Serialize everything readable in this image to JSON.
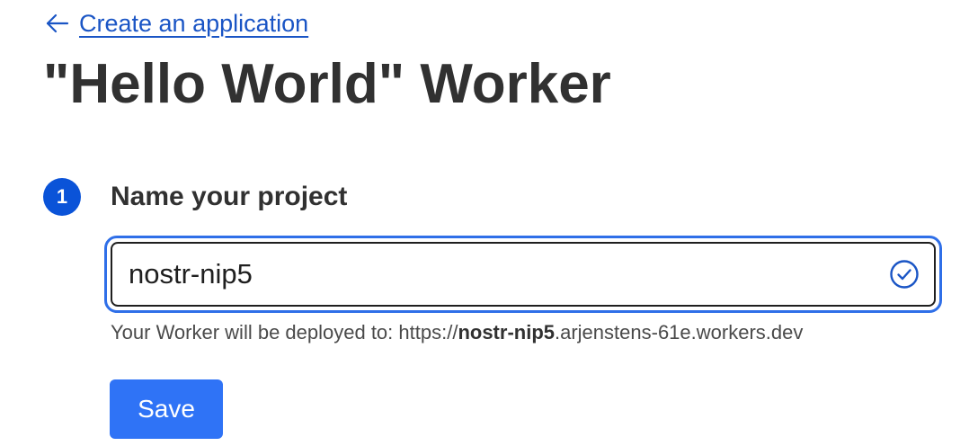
{
  "nav": {
    "back_label": "Create an application",
    "back_icon": "arrow-left-icon"
  },
  "page": {
    "title": "\"Hello World\" Worker"
  },
  "step": {
    "number": "1",
    "title": "Name your project"
  },
  "project_input": {
    "value": "nostr-nip5",
    "valid_icon": "check-circle-icon"
  },
  "deploy": {
    "prefix": "Your Worker will be deployed to: https://",
    "subdomain": "nostr-nip5",
    "suffix": ".arjenstens-61e.workers.dev"
  },
  "actions": {
    "save_label": "Save"
  },
  "colors": {
    "link": "#1a55c5",
    "accent": "#2f73f6",
    "badge": "#0a53d8",
    "focus_ring": "#2f6fe8"
  }
}
